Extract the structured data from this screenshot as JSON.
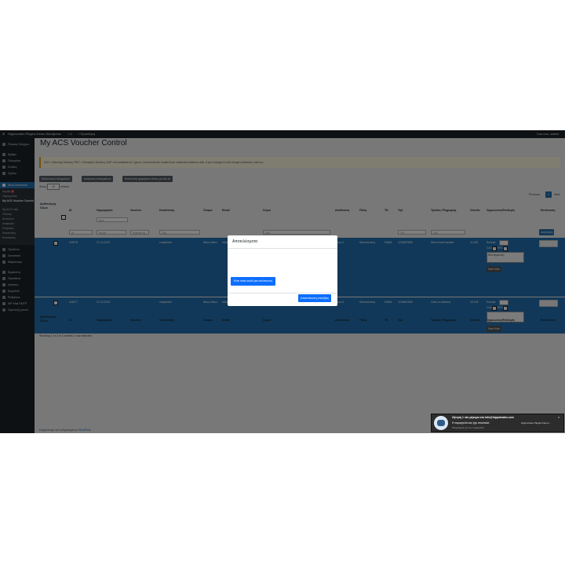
{
  "adminbar": {
    "site_name": "Hippocrates Plugins Demo Wordpress",
    "new_label": "Προσθήκη",
    "user_greeting": "Γεια σου, admin"
  },
  "sidebar": {
    "items": [
      {
        "label": "Πίνακας Ελέγχου",
        "icon": "dashboard-icon"
      },
      {
        "label": "Άρθρα",
        "icon": "pin-icon"
      },
      {
        "label": "Πολυμέσα",
        "icon": "media-icon"
      },
      {
        "label": "Σελίδες",
        "icon": "page-icon"
      },
      {
        "label": "Σχόλια",
        "icon": "comment-icon"
      },
      {
        "label": "WooCommerce",
        "icon": "woo-icon"
      }
    ],
    "submenu": [
      {
        "label": "Αρχική",
        "badge": "1"
      },
      {
        "label": "Παραγγελίες"
      },
      {
        "label": "My ACS Voucher Control"
      },
      {
        "label": "My ACS Lists"
      },
      {
        "label": "Πελάτες"
      },
      {
        "label": "Κουπόνια"
      },
      {
        "label": "Αναφορές"
      },
      {
        "label": "Ρυθμίσεις"
      },
      {
        "label": "Κατάσταση"
      },
      {
        "label": "Επεκτάσεις"
      }
    ],
    "items2": [
      {
        "label": "Προϊόντα",
        "icon": "product-icon"
      },
      {
        "label": "Στατιστικά",
        "icon": "stats-icon"
      },
      {
        "label": "Μάρκετινγκ",
        "icon": "megaphone-icon"
      },
      {
        "label": "Εμφάνιση",
        "icon": "brush-icon"
      },
      {
        "label": "Πρόσθετα",
        "icon": "plugin-icon"
      },
      {
        "label": "Χρήστες",
        "icon": "user-icon"
      },
      {
        "label": "Εργαλεία",
        "icon": "tool-icon"
      },
      {
        "label": "Ρυθμίσεις",
        "icon": "settings-icon"
      },
      {
        "label": "WP Mail SMTP",
        "icon": "mail-icon"
      },
      {
        "label": "Σύμπτυξη μενού",
        "icon": "collapse-icon"
      }
    ]
  },
  "page": {
    "title": "My ACS Voucher Control",
    "notice": "SAT = Saturday Delivery, REC = Reception Delivery, DAP: not available for Cyprus. Comments are loaded from customers address note. If you change it it will change customers note too.",
    "buttons": [
      "Εκτύπωση επιλεγμένων",
      "Ακύρωση επιλεγμένων",
      "Εκτύπωση ημερήσιας λίστας με όλα τα"
    ],
    "show_label": "Show",
    "show_value": "10",
    "entries_label": "entries",
    "pager": {
      "previous": "Previous",
      "current": "1",
      "next": "Next"
    }
  },
  "table": {
    "headers": [
      "Αν/Επιλογή Όλων",
      "ID",
      "Ημερομηνία",
      "Voucher",
      "Κατάσταση",
      "Όνομα",
      "Email",
      "Χώρα",
      "Διεύθυνση",
      "Πόλη",
      "TK",
      "Τηλ.",
      "Τρόπος Πληρωμής",
      "Σύνολο",
      "Σημειώσεις/Επιλογές",
      "Εκτύπωση"
    ],
    "filters": {
      "id": "id",
      "date": "Ημ/νία",
      "voucher": "Voucher nu",
      "status": "Όλα",
      "country": "Όλα",
      "phone": "Τηλ",
      "payment": "Όλα",
      "date_range": "Από",
      "filter_button": "Αναζήτηση"
    },
    "rows": [
      {
        "id": "115078",
        "date": "27-10-2022",
        "status": "completed",
        "name": "Νίκος Νίκου",
        "email": "info@hippokrates.com",
        "country": "GR",
        "address": "Νίκου 2",
        "city": "Θεσσαλονίκη",
        "tk": "54646",
        "phone": "1234567890",
        "payment": "Direct bank transfer",
        "total": "11,00€",
        "notes_placeholder": "Νέα σημείωση",
        "save_label": "Save Note"
      },
      {
        "id": "115077",
        "date": "27-10-2022",
        "status": "completed",
        "name": "Νίκος Νίκου",
        "email": "info@hippokrates.com",
        "country": "GR",
        "address": "Νίκου 2",
        "city": "Θεσσαλονίκη",
        "tk": "54646",
        "phone": "1234567890",
        "payment": "Cash on delivery",
        "total": "15,10€",
        "notes_placeholder": "",
        "save_label": "Save Note"
      }
    ],
    "option_labels": {
      "receipt": "Receipt",
      "cod": "CoD",
      "rec": "REC"
    },
    "footer_text": "Showing 1 to 2 of 2 entries   1 row selected"
  },
  "footer": {
    "text": "Ευχαριστούμε για τη δημιουργία με",
    "link": "WordPress"
  },
  "modal": {
    "title": "Αποτελέσματα",
    "message": "Κάτι πάει καλά για εκτύπωση",
    "ok_label": "Αποτύπωση επιλέξας"
  },
  "toast": {
    "title": "Ζήτηση 1 νέο μήνυμα στο info@hippokrates.com",
    "body": "Η παραγγελία σας έχει αποσταλεί",
    "source": "Πληροφορίες για την παραγγελία",
    "app": "Hippocrates Plugins Demo ..."
  },
  "colors": {
    "adminbar": "#1d2327",
    "accent": "#2271b1",
    "modal_button": "#0d6efd",
    "overlay": "rgba(0,0,0,0.5)"
  }
}
